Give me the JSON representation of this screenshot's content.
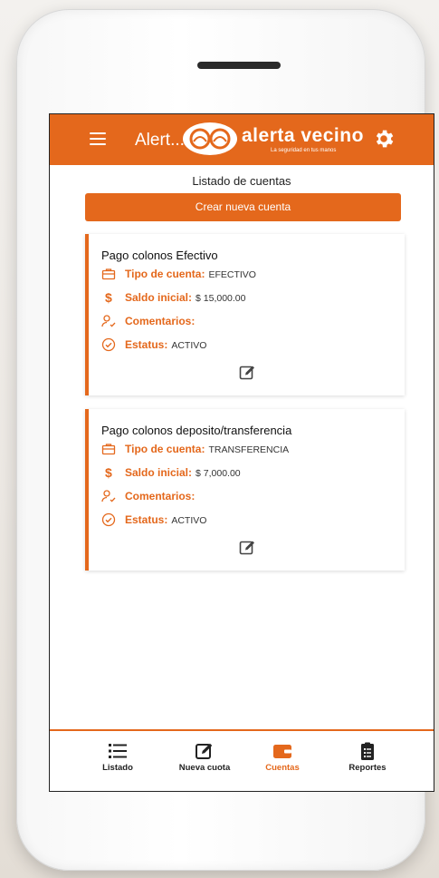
{
  "app": {
    "title": "Alert...",
    "logo_name": "alerta vecino",
    "logo_tagline": "La seguridad en tus manos"
  },
  "page": {
    "heading": "Listado de cuentas",
    "create_button": "Crear nueva cuenta"
  },
  "field_labels": {
    "type": "Tipo de cuenta:",
    "balance": "Saldo inicial:",
    "comments": "Comentarios:",
    "status": "Estatus:"
  },
  "accounts": [
    {
      "name": "Pago colonos Efectivo",
      "type": "EFECTIVO",
      "balance": "$ 15,000.00",
      "comments": "",
      "status": "ACTIVO"
    },
    {
      "name": "Pago colonos deposito/transferencia",
      "type": "TRANSFERENCIA",
      "balance": "$ 7,000.00",
      "comments": "",
      "status": "ACTIVO"
    }
  ],
  "nav": [
    {
      "label": "Listado",
      "icon": "list-icon",
      "active": false
    },
    {
      "label": "Nueva cuota",
      "icon": "edit-icon",
      "active": false
    },
    {
      "label": "Cuentas",
      "icon": "wallet-icon",
      "active": true
    },
    {
      "label": "Reportes",
      "icon": "clipboard-icon",
      "active": false
    }
  ],
  "colors": {
    "accent": "#e4681c",
    "text": "#222222"
  }
}
